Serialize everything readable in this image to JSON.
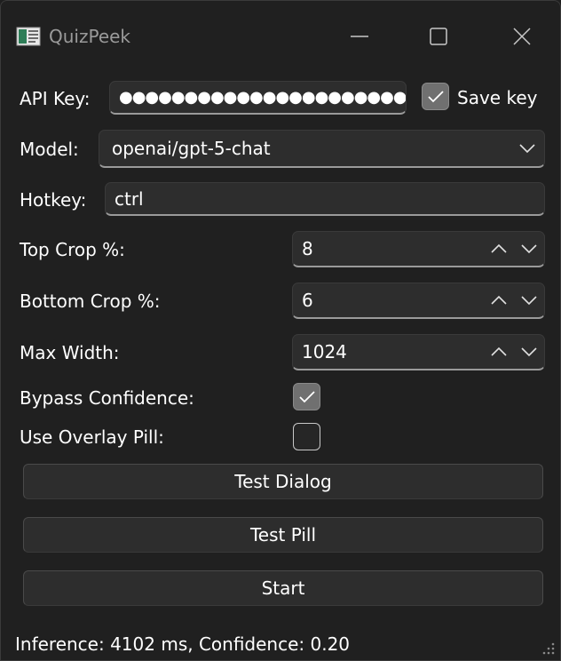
{
  "window": {
    "title": "QuizPeek",
    "app_icon": "app-icon",
    "controls": [
      "minimize-icon",
      "maximize-icon",
      "close-icon"
    ]
  },
  "api_key": {
    "label": "API Key:",
    "value": "●●●●●●●●●●●●●●●●●●●●●●",
    "save_key_label": "Save key",
    "save_key_checked": true
  },
  "model": {
    "label": "Model:",
    "value": "openai/gpt-5-chat"
  },
  "hotkey": {
    "label": "Hotkey:",
    "value": "ctrl"
  },
  "top_crop": {
    "label": "Top Crop %:",
    "value": "8"
  },
  "bottom_crop": {
    "label": "Bottom Crop %:",
    "value": "6"
  },
  "max_width": {
    "label": "Max Width:",
    "value": "1024"
  },
  "bypass_confidence": {
    "label": "Bypass Confidence:",
    "checked": true
  },
  "use_overlay_pill": {
    "label": "Use Overlay Pill:",
    "checked": false
  },
  "buttons": {
    "test_dialog": "Test Dialog",
    "test_pill": "Test Pill",
    "start": "Start"
  },
  "status": {
    "text": "Inference: 4102 ms, Confidence: 0.20"
  },
  "colors": {
    "background": "#202020",
    "field_bg": "#2d2d2d",
    "checkbox_checked": "#707070"
  }
}
